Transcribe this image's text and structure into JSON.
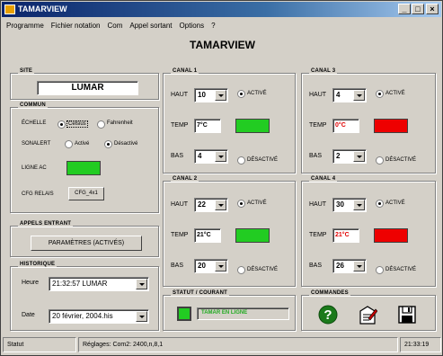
{
  "window": {
    "title": "TAMARVIEW",
    "min": "_",
    "max": "□",
    "close": "×"
  },
  "menu": [
    "Programme",
    "Fichier notation",
    "Com",
    "Appel sortant",
    "Options",
    "?"
  ],
  "app_title": "TAMARVIEW",
  "site": {
    "label": "SITE",
    "value": "LUMAR"
  },
  "commun": {
    "label": "COMMUN",
    "echelle_label": "ÉCHELLE",
    "celsius": "Celsius",
    "fahrenheit": "Fahrenheit",
    "sonalert_label": "SONALERT",
    "active": "Activé",
    "desactive": "Désactivé",
    "ligne_ac_label": "LIGNE AC",
    "ligne_ac_color": "#22cc22",
    "cfg_relais_label": "CFG RELAIS",
    "cfg_relais_value": "CFG_4x1"
  },
  "appels": {
    "label": "APPELS ENTRANT",
    "button": "PARAMÈTRES (ACTIVÉS)"
  },
  "historique": {
    "label": "HISTORIQUE",
    "heure_label": "Heure",
    "heure_value": "21:32:57  LUMAR",
    "date_label": "Date",
    "date_value": "20 février, 2004.his"
  },
  "channels": [
    {
      "label": "CANAL 1",
      "haut_label": "HAUT",
      "haut": "10",
      "temp_label": "TEMP",
      "temp": "7°C",
      "temp_alarm": false,
      "bas_label": "BAS",
      "bas": "4",
      "active_label": "ACTIVÉ",
      "desactive_label": "DÉSACTIVÉ",
      "led_color": "#22cc22"
    },
    {
      "label": "CANAL 3",
      "haut_label": "HAUT",
      "haut": "4",
      "temp_label": "TEMP",
      "temp": "0°C",
      "temp_alarm": true,
      "bas_label": "BAS",
      "bas": "2",
      "active_label": "ACTIVÉ",
      "desactive_label": "DÉSACTIVÉ",
      "led_color": "#ee0000"
    },
    {
      "label": "CANAL 2",
      "haut_label": "HAUT",
      "haut": "22",
      "temp_label": "TEMP",
      "temp": "21°C",
      "temp_alarm": false,
      "bas_label": "BAS",
      "bas": "20",
      "active_label": "ACTIVÉ",
      "desactive_label": "DÉSACTIVÉ",
      "led_color": "#22cc22"
    },
    {
      "label": "CANAL 4",
      "haut_label": "HAUT",
      "haut": "30",
      "temp_label": "TEMP",
      "temp": "21°C",
      "temp_alarm": true,
      "bas_label": "BAS",
      "bas": "26",
      "active_label": "ACTIVÉ",
      "desactive_label": "DÉSACTIVÉ",
      "led_color": "#ee0000"
    }
  ],
  "statut": {
    "label": "STATUT / COURANT",
    "text": "TAMAR EN LIGNE",
    "led_color": "#22cc22",
    "text_color": "#22aa22"
  },
  "commandes": {
    "label": "COMMANDES",
    "help_icon": "help-icon",
    "edit_icon": "notepad-icon",
    "save_icon": "floppy-icon"
  },
  "statusbar": {
    "status": "Statut",
    "settings": "Réglages: Com2: 2400,n,8,1",
    "time": "21:33:19"
  }
}
